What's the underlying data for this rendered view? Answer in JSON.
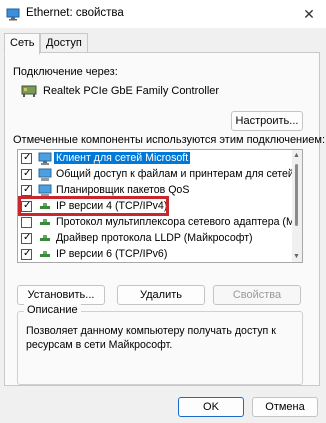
{
  "window": {
    "title": "Ethernet: свойства",
    "close_glyph": "✕",
    "icon": "network-adapter-icon"
  },
  "tabs": [
    {
      "label": "Сеть",
      "active": true
    },
    {
      "label": "Доступ",
      "active": false
    }
  ],
  "connect_via": {
    "label": "Подключение через:",
    "adapter_name": "Realtek PCIe GbE Family Controller",
    "configure_button": "Настроить..."
  },
  "components": {
    "label": "Отмеченные компоненты используются этим подключением:",
    "items": [
      {
        "label": "Клиент для сетей Microsoft",
        "checked": true,
        "selected": true,
        "icon": "network-client-icon"
      },
      {
        "label": "Общий доступ к файлам и принтерам для сетей Mi",
        "checked": true,
        "selected": false,
        "icon": "network-service-icon"
      },
      {
        "label": "Планировщик пакетов QoS",
        "checked": true,
        "selected": false,
        "icon": "network-service-icon"
      },
      {
        "label": "IP версии 4 (TCP/IPv4)",
        "checked": true,
        "selected": false,
        "icon": "protocol-icon"
      },
      {
        "label": "Протокол мультиплексора сетевого адаптера (Май",
        "checked": false,
        "selected": false,
        "icon": "protocol-icon"
      },
      {
        "label": "Драйвер протокола LLDP (Майкрософт)",
        "checked": true,
        "selected": false,
        "icon": "protocol-icon"
      },
      {
        "label": "IP версии 6 (TCP/IPv6)",
        "checked": true,
        "selected": false,
        "icon": "protocol-icon"
      }
    ],
    "scroll_up": "▲",
    "scroll_down": "▼"
  },
  "actions": {
    "install": "Установить...",
    "remove": "Удалить",
    "properties": "Свойства"
  },
  "description": {
    "legend": "Описание",
    "text": "Позволяет данному компьютеру получать доступ к ресурсам в сети Майкрософт."
  },
  "footer": {
    "ok": "OK",
    "cancel": "Отмена"
  },
  "colors": {
    "selection": "#0078d7",
    "highlight_box": "#c8282d",
    "accent_button_border": "#1b6ac9"
  }
}
